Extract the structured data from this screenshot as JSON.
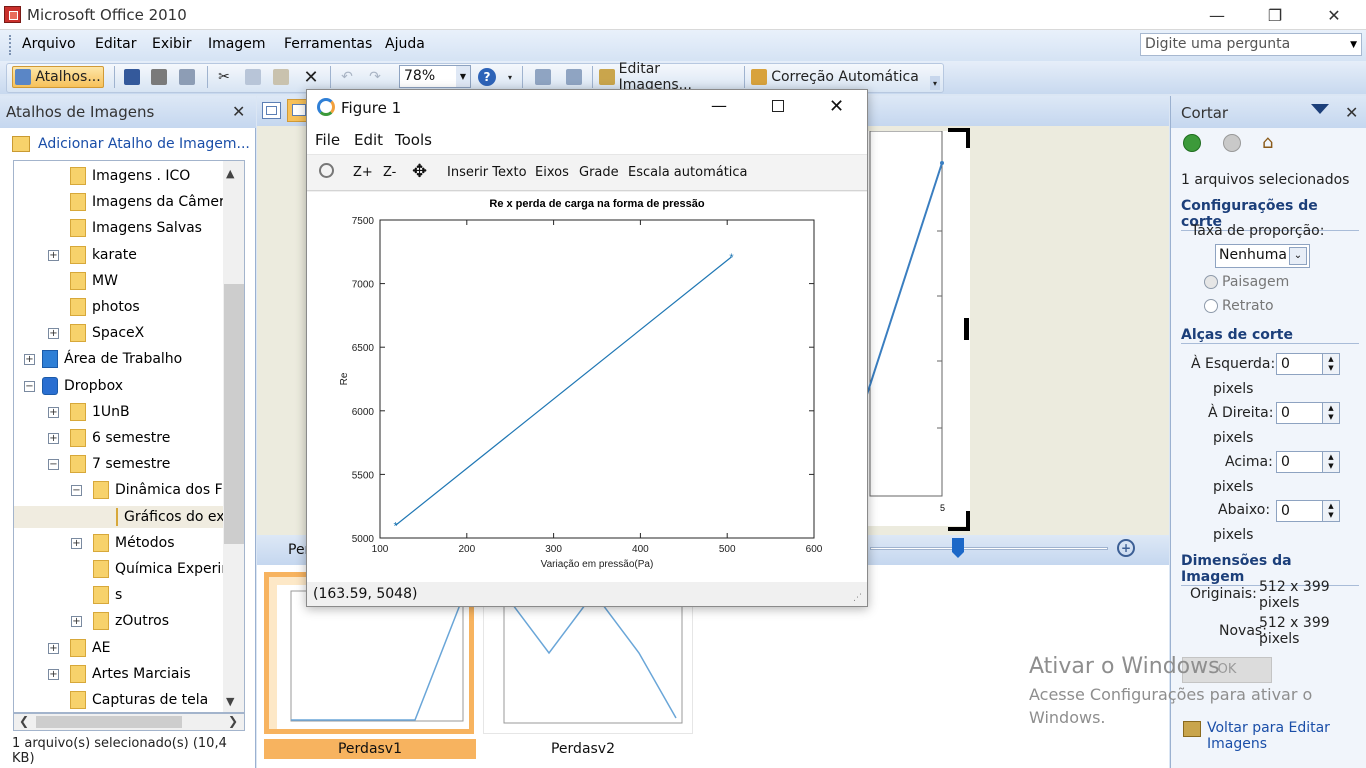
{
  "app": {
    "title": "Microsoft Office 2010"
  },
  "menu": {
    "items": [
      "Arquivo",
      "Editar",
      "Exibir",
      "Imagem",
      "Ferramentas",
      "Ajuda"
    ],
    "ask_placeholder": "Digite uma pergunta"
  },
  "toolbar": {
    "shortcuts_label": "Atalhos...",
    "zoom": "78%",
    "edit_images": "Editar Imagens...",
    "auto_correct": "Correção Automática"
  },
  "left_pane": {
    "title": "Atalhos de Imagens",
    "add_shortcut": "Adicionar Atalho de Imagem...",
    "tree": [
      {
        "label": "Imagens . ICO",
        "level": 2,
        "expander": ""
      },
      {
        "label": "Imagens da Câmera",
        "level": 2,
        "expander": ""
      },
      {
        "label": "Imagens Salvas",
        "level": 2,
        "expander": ""
      },
      {
        "label": "karate",
        "level": 2,
        "expander": "+"
      },
      {
        "label": "MW",
        "level": 2,
        "expander": ""
      },
      {
        "label": "photos",
        "level": 2,
        "expander": ""
      },
      {
        "label": "SpaceX",
        "level": 2,
        "expander": "+"
      },
      {
        "label": "Área de Trabalho",
        "level": 1,
        "expander": "+"
      },
      {
        "label": "Dropbox",
        "level": 1,
        "expander": "−"
      },
      {
        "label": "1UnB",
        "level": 2,
        "expander": "+"
      },
      {
        "label": "6 semestre",
        "level": 2,
        "expander": "+"
      },
      {
        "label": "7 semestre",
        "level": 2,
        "expander": "−"
      },
      {
        "label": "Dinâmica dos Fluidos",
        "level": 3,
        "expander": "−"
      },
      {
        "label": "Gráficos do ex",
        "level": 4,
        "expander": ""
      },
      {
        "label": "Métodos",
        "level": 3,
        "expander": "+"
      },
      {
        "label": "Química Experimental",
        "level": 3,
        "expander": ""
      },
      {
        "label": "s",
        "level": 3,
        "expander": ""
      },
      {
        "label": "zOutros",
        "level": 3,
        "expander": "+"
      },
      {
        "label": "AE",
        "level": 2,
        "expander": "+"
      },
      {
        "label": "Artes Marciais",
        "level": 2,
        "expander": "+"
      },
      {
        "label": "Capturas de tela",
        "level": 2,
        "expander": ""
      }
    ],
    "status": "1 arquivo(s) selecionado(s) (10,4 KB)"
  },
  "center": {
    "slider_label": "Per",
    "thumbs": [
      {
        "name": "Perdasv1"
      },
      {
        "name": "Perdasv2"
      }
    ],
    "preview_tick": "5"
  },
  "right_pane": {
    "title": "Cortar",
    "selected": "1 arquivos selecionados",
    "section_crop": "Configurações de corte",
    "ratio_label": "Taxa de proporção:",
    "ratio_value": "Nenhuma",
    "landscape": "Paisagem",
    "portrait": "Retrato",
    "section_handles": "Alças de corte",
    "left_label": "À Esquerda:",
    "right_label": "À Direita:",
    "top_label": "Acima:",
    "bottom_label": "Abaixo:",
    "pixels": "pixels",
    "left_val": "0",
    "right_val": "0",
    "top_val": "0",
    "bottom_val": "0",
    "section_dims": "Dimensões da Imagem",
    "original_label": "Originais:",
    "original_val": "512 x 399",
    "new_label": "Novas:",
    "new_val": "512 x 399",
    "ok": "OK",
    "back_link": "Voltar para Editar Imagens"
  },
  "watermark": {
    "line1": "Ativar o Windows",
    "line2": "Acesse Configurações para ativar o",
    "line3": "Windows."
  },
  "figure": {
    "title": "Figure 1",
    "menu": [
      "File",
      "Edit",
      "Tools"
    ],
    "tools": {
      "zoom_in": "Z+",
      "zoom_out": "Z-",
      "insert_text": "Inserir Texto",
      "axes": "Eixos",
      "grid": "Grade",
      "autoscale": "Escala automática"
    },
    "status": "(163.59, 5048)"
  },
  "chart_data": {
    "type": "line",
    "title": "Re x perda de carga na forma de pressão",
    "xlabel": "Variação em pressão(Pa)",
    "ylabel": "Re",
    "xlim": [
      100,
      600
    ],
    "ylim": [
      5000,
      7500
    ],
    "xticks": [
      100,
      200,
      300,
      400,
      500,
      600
    ],
    "yticks": [
      5000,
      5500,
      6000,
      6500,
      7000,
      7500
    ],
    "series": [
      {
        "x": [
          118,
          505
        ],
        "y": [
          5100,
          7210
        ]
      }
    ],
    "grid": false,
    "color": "#1f77b4"
  }
}
